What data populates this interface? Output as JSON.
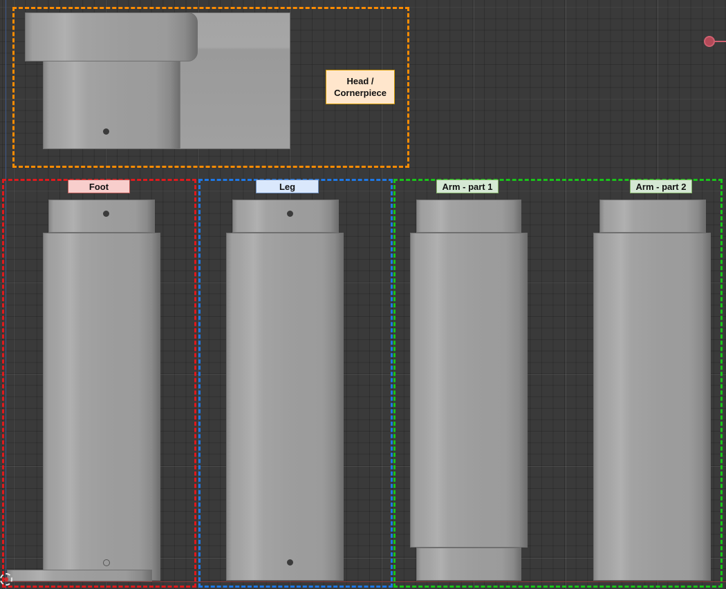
{
  "labels": {
    "head": "Head / Cornerpiece",
    "foot": "Foot",
    "leg": "Leg",
    "arm1": "Arm - part 1",
    "arm2": "Arm - part 2"
  },
  "colors": {
    "head_frame": "#ff8c00",
    "foot_frame": "#e0191c",
    "leg_frame": "#1e78e6",
    "arm_frame": "#19c419",
    "head_label_bg": "#ffe6cc",
    "foot_label_bg": "#f8cecc",
    "leg_label_bg": "#dae8fc",
    "arm_label_bg": "#d5e8d4",
    "viewport_bg": "#3a3a3a",
    "part_grey": "#a0a0a0"
  },
  "icons": {
    "light": "light-source-icon",
    "origin": "world-origin-icon"
  }
}
